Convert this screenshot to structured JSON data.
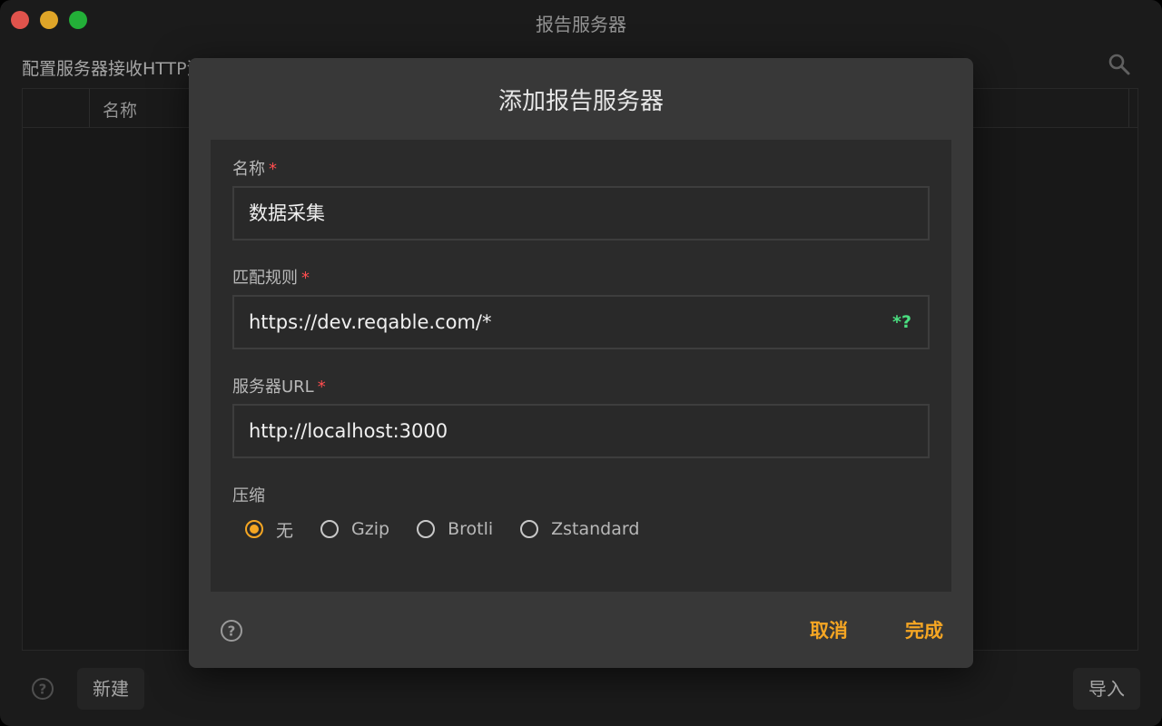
{
  "window": {
    "title": "报告服务器"
  },
  "page": {
    "description": "配置服务器接收HTTP流量并生成报告",
    "table": {
      "columns": [
        "名称"
      ]
    },
    "bottom_bar": {
      "new_label": "新建",
      "import_label": "导入"
    }
  },
  "dialog": {
    "title": "添加报告服务器",
    "fields": {
      "name": {
        "label": "名称",
        "required_mark": "*",
        "value": "数据采集"
      },
      "match_rule": {
        "label": "匹配规则",
        "required_mark": "*",
        "value": "https://dev.reqable.com/*",
        "regex_toggle": "*?"
      },
      "server_url": {
        "label": "服务器URL",
        "required_mark": "*",
        "value": "http://localhost:3000"
      }
    },
    "compression": {
      "label": "压缩",
      "options": [
        "无",
        "Gzip",
        "Brotli",
        "Zstandard"
      ],
      "selected": "无"
    },
    "buttons": {
      "cancel": "取消",
      "done": "完成"
    }
  },
  "colors": {
    "accent": "#f5a623",
    "required": "#ff4d4f",
    "regex_toggle": "#4ade80",
    "dialog_bg": "#383838",
    "panel_bg": "#2b2b2b",
    "window_bg": "#1f1f1f"
  },
  "icons": {
    "search": "search-icon",
    "help": "help-icon"
  }
}
